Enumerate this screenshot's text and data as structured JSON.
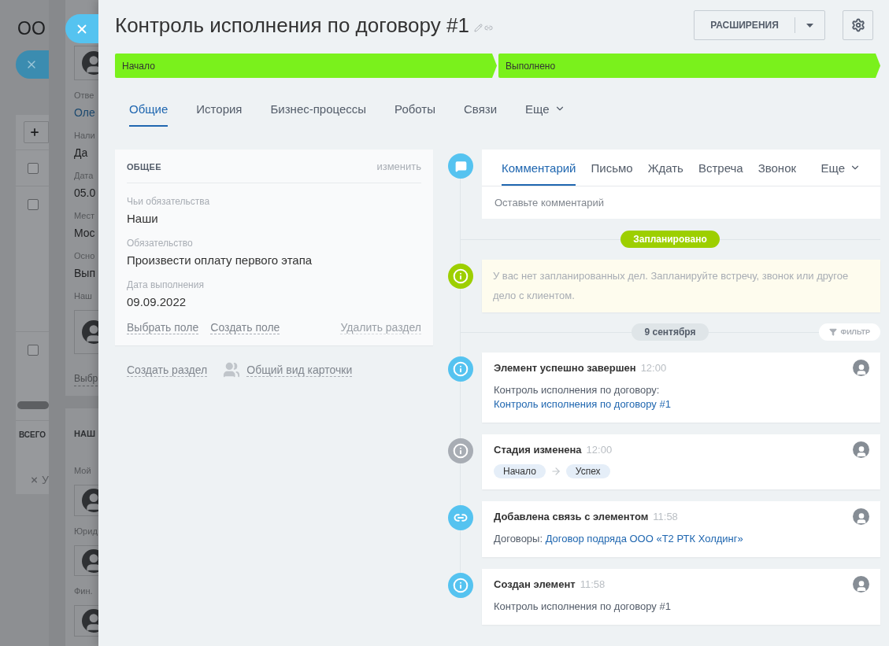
{
  "background_page": {
    "title": "ОО",
    "rows": [
      {
        "checked": false
      },
      {
        "checked": false
      },
      {
        "checked": false
      }
    ],
    "total_label": "ВСЕГО",
    "cancel_label": "У"
  },
  "background_card": {
    "sections": [
      {
        "items": [
          {
            "kind": "avatar"
          },
          {
            "kind": "label",
            "text": "Отве"
          },
          {
            "kind": "link",
            "text": "Оле"
          },
          {
            "kind": "label",
            "text": "Нали"
          },
          {
            "kind": "value",
            "text": "Да"
          },
          {
            "kind": "label",
            "text": "Дата"
          },
          {
            "kind": "value",
            "text": "05.0"
          },
          {
            "kind": "label",
            "text": "Мест"
          },
          {
            "kind": "value",
            "text": "Мос"
          },
          {
            "kind": "label",
            "text": "Осно"
          },
          {
            "kind": "value",
            "text": "Вып"
          },
          {
            "kind": "label",
            "text": "Наш"
          },
          {
            "kind": "avatar"
          },
          {
            "kind": "action",
            "text": "Выбр"
          }
        ]
      },
      {
        "items": [
          {
            "kind": "heading",
            "text": "НАШ"
          },
          {
            "kind": "label",
            "text": "Мой"
          },
          {
            "kind": "avatar"
          },
          {
            "kind": "label",
            "text": "Юрид"
          },
          {
            "kind": "avatar"
          },
          {
            "kind": "label",
            "text": "Фин."
          },
          {
            "kind": "avatar"
          }
        ]
      }
    ]
  },
  "panel": {
    "title": "Контроль исполнения по договору #1",
    "extensions_button": "РАСШИРЕНИЯ",
    "stages": [
      {
        "label": "Начало",
        "done": true
      },
      {
        "label": "Выполнено",
        "done": true
      }
    ],
    "tabs": [
      {
        "label": "Общие",
        "selected": true
      },
      {
        "label": "История",
        "selected": false
      },
      {
        "label": "Бизнес-процессы",
        "selected": false
      },
      {
        "label": "Роботы",
        "selected": false
      },
      {
        "label": "Связи",
        "selected": false
      },
      {
        "label": "Еще",
        "selected": false,
        "kind": "more"
      }
    ],
    "section": {
      "title": "ОБЩЕЕ",
      "edit_link": "изменить",
      "fields": [
        {
          "label": "Чьи обязательства",
          "value": "Наши"
        },
        {
          "label": "Обязательство",
          "value": "Произвести оплату первого этапа"
        },
        {
          "label": "Дата выполнения",
          "value": "09.09.2022"
        }
      ],
      "actions": [
        "Выбрать поле",
        "Создать поле"
      ],
      "delete_action": "Удалить раздел"
    },
    "section_links": {
      "create": "Создать раздел",
      "card_view": "Общий вид карточки"
    },
    "composer": {
      "tabs": [
        {
          "label": "Комментарий",
          "selected": true
        },
        {
          "label": "Письмо",
          "selected": false
        },
        {
          "label": "Ждать",
          "selected": false
        },
        {
          "label": "Встреча",
          "selected": false
        },
        {
          "label": "Звонок",
          "selected": false
        },
        {
          "label": "Еще",
          "selected": false,
          "kind": "more"
        }
      ],
      "placeholder": "Оставьте комментарий"
    },
    "planned_badge": "Запланировано",
    "notice": "У вас нет запланированных дел. Запланируйте встречу, звонок или другое дело с клиентом.",
    "date_badge": "9 сентября",
    "filter_button": "ФИЛЬТР",
    "events": [
      {
        "kind": "completed",
        "color": "#55c3f0",
        "title": "Элемент успешно завершен",
        "time": "12:00",
        "prefix": "Контроль исполнения по договору:",
        "link": "Контроль исполнения по договору #1"
      },
      {
        "kind": "stage_change",
        "color": "#a8adb4",
        "title": "Стадия изменена",
        "time": "12:00",
        "from": "Начало",
        "to": "Успех"
      },
      {
        "kind": "link_added",
        "color": "#55c3f0",
        "title": "Добавлена связь с элементом",
        "time": "11:58",
        "prefix": "Договоры:",
        "link": "Договор подряда ООО «Т2 РТК Холдинг»"
      },
      {
        "kind": "created",
        "color": "#55c3f0",
        "title": "Создан элемент",
        "time": "11:58",
        "text": "Контроль исполнения по договору #1"
      }
    ]
  }
}
